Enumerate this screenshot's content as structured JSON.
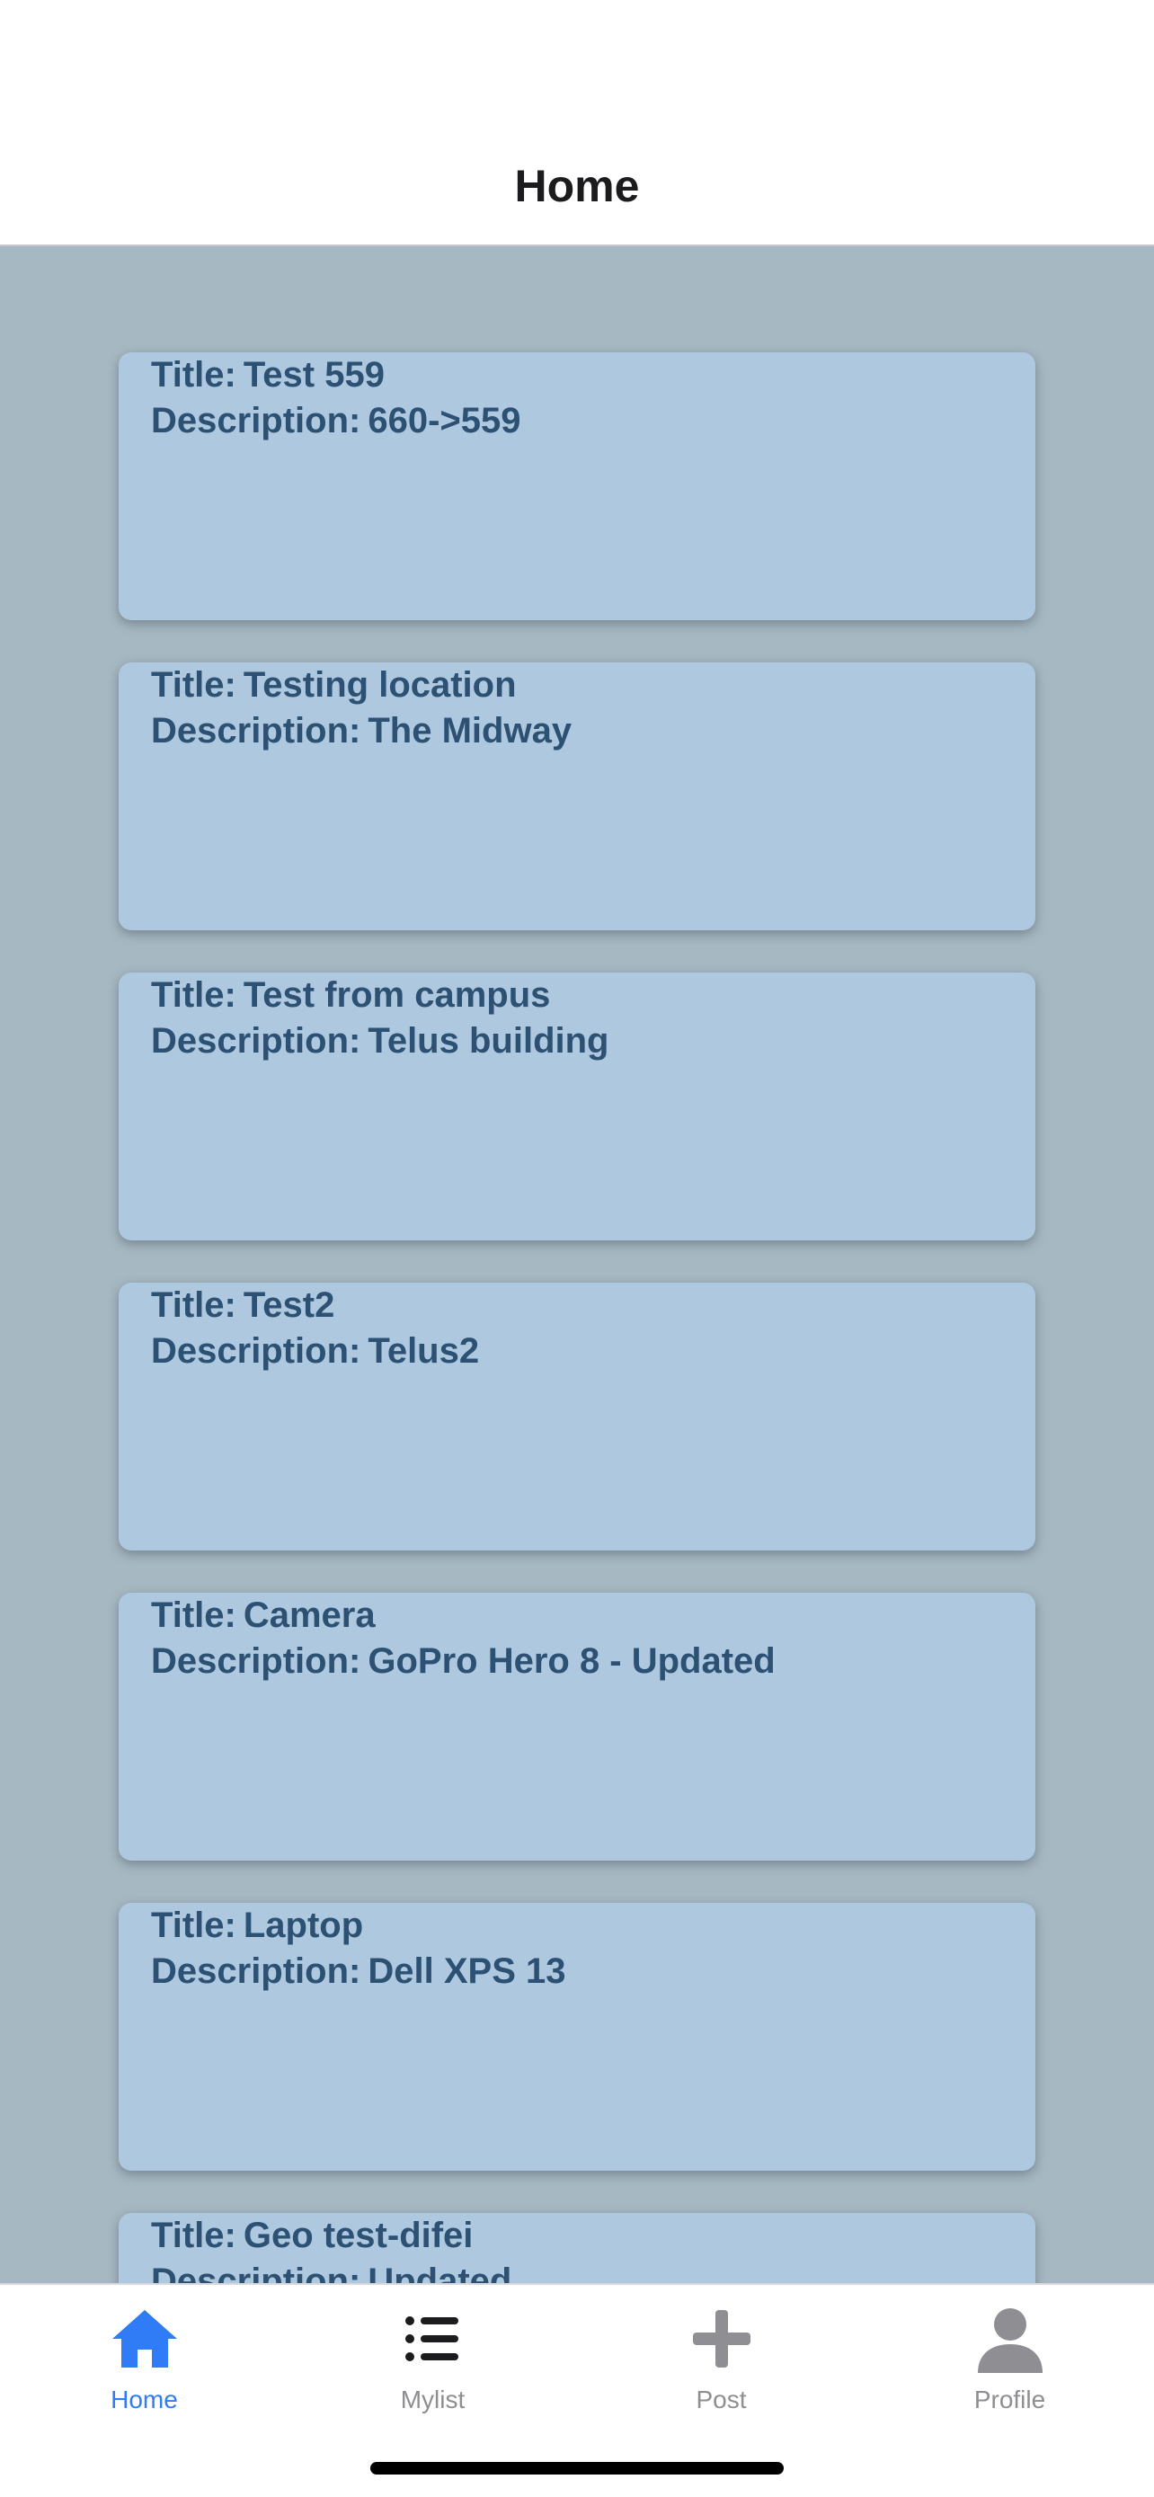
{
  "header": {
    "title": "Home"
  },
  "posts": [
    {
      "title_label": "Title:",
      "title": "Test 559",
      "desc_label": "Description:",
      "description": "660->559"
    },
    {
      "title_label": "Title:",
      "title": "Testing location",
      "desc_label": "Description:",
      "description": "The Midway"
    },
    {
      "title_label": "Title:",
      "title": "Test from campus",
      "desc_label": "Description:",
      "description": "Telus building"
    },
    {
      "title_label": "Title:",
      "title": "Test2",
      "desc_label": "Description:",
      "description": "Telus2"
    },
    {
      "title_label": "Title:",
      "title": "Camera",
      "desc_label": "Description:",
      "description": "GoPro Hero 8 - Updated"
    },
    {
      "title_label": "Title:",
      "title": "Laptop",
      "desc_label": "Description:",
      "description": "Dell XPS 13"
    },
    {
      "title_label": "Title:",
      "title": "Geo test-difei",
      "desc_label": "Description:",
      "description": "Updated"
    }
  ],
  "tabs": [
    {
      "label": "Home",
      "icon": "home-icon",
      "active": true
    },
    {
      "label": "Mylist",
      "icon": "list-icon",
      "active": false
    },
    {
      "label": "Post",
      "icon": "plus-icon",
      "active": false
    },
    {
      "label": "Profile",
      "icon": "person-icon",
      "active": false
    }
  ],
  "colors": {
    "accent": "#2f7cf6",
    "inactive": "#8e8e93",
    "card_bg": "#aec8e0",
    "card_text": "#2c5173",
    "content_bg": "#a6b8c2"
  }
}
